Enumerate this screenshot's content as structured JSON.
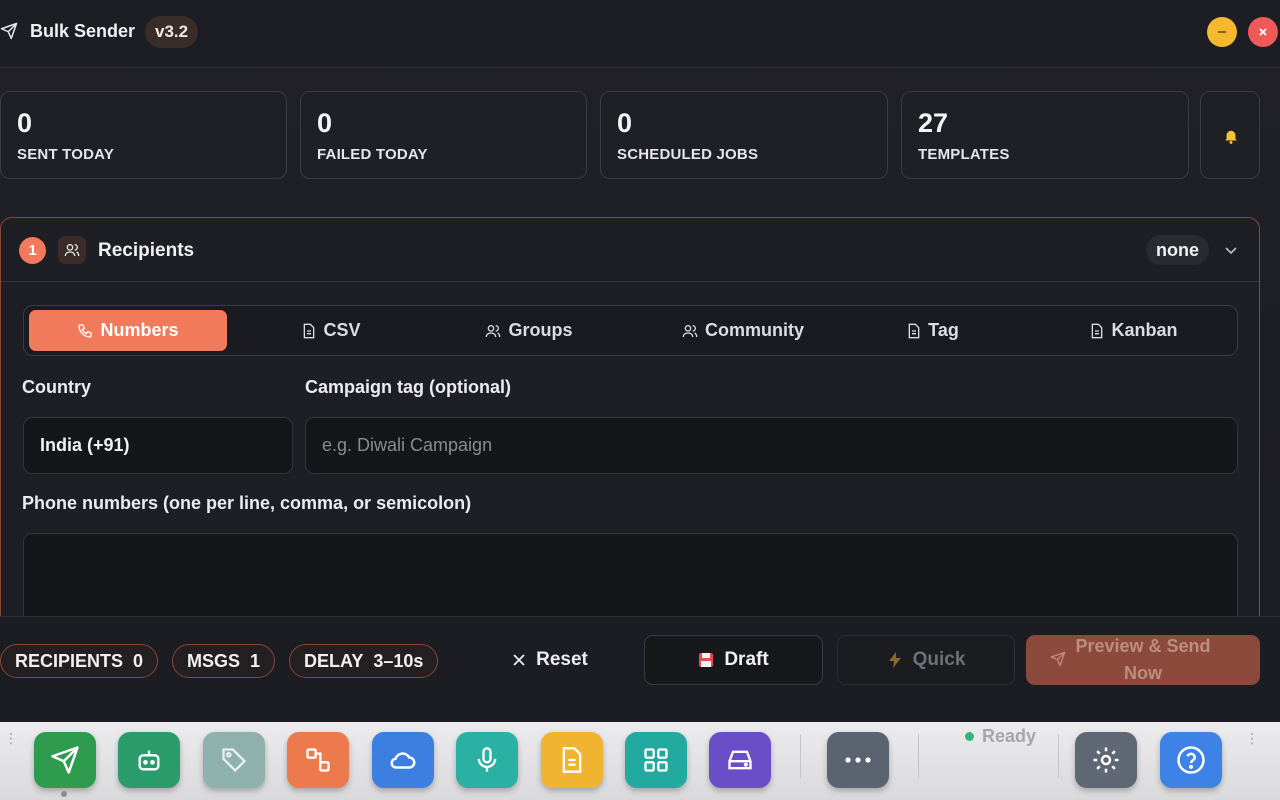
{
  "window": {
    "title": "Bulk Sender",
    "version": "v3.2",
    "title_icon": "send-icon",
    "minimize_icon": "minimize-icon",
    "close_icon": "close-icon"
  },
  "stats": [
    {
      "value": "0",
      "label": "SENT TODAY"
    },
    {
      "value": "0",
      "label": "FAILED TODAY"
    },
    {
      "value": "0",
      "label": "SCHEDULED JOBS"
    },
    {
      "value": "27",
      "label": "TEMPLATES"
    }
  ],
  "notifications_icon": "bell-icon",
  "recipients": {
    "step": "1",
    "title": "Recipients",
    "selection": "none",
    "tabs": [
      {
        "label": "Numbers",
        "icon": "phone-icon",
        "active": true
      },
      {
        "label": "CSV",
        "icon": "file-icon",
        "active": false
      },
      {
        "label": "Groups",
        "icon": "users-icon",
        "active": false
      },
      {
        "label": "Community",
        "icon": "users-icon",
        "active": false
      },
      {
        "label": "Tag",
        "icon": "file-icon",
        "active": false
      },
      {
        "label": "Kanban",
        "icon": "file-icon",
        "active": false
      }
    ],
    "country_label": "Country",
    "country_value": "India (+91)",
    "campaign_label": "Campaign tag (optional)",
    "campaign_placeholder": "e.g. Diwali Campaign",
    "campaign_value": "",
    "phones_label": "Phone numbers (one per line, comma, or semicolon)",
    "phones_value": ""
  },
  "actionbar": {
    "chips": [
      {
        "label": "RECIPIENTS",
        "value": "0"
      },
      {
        "label": "MSGS",
        "value": "1"
      },
      {
        "label": "DELAY",
        "value": "3–10s"
      }
    ],
    "reset_label": "Reset",
    "draft_label": "Draft",
    "quick_label": "Quick",
    "send_label_line1": "Preview & Send",
    "send_label_line2": "Now"
  },
  "dock": {
    "apps": [
      {
        "name": "send",
        "icon": "send-icon",
        "color": "#2e9b4e"
      },
      {
        "name": "bot",
        "icon": "bot-icon",
        "color": "#2a9c6c"
      },
      {
        "name": "tag",
        "icon": "tag-icon",
        "color": "#8fb1ad"
      },
      {
        "name": "flow",
        "icon": "flow-icon",
        "color": "#ec7a4c"
      },
      {
        "name": "cloud",
        "icon": "cloud-icon",
        "color": "#3c7fe0"
      },
      {
        "name": "mic",
        "icon": "mic-icon",
        "color": "#2bb1a4"
      },
      {
        "name": "document",
        "icon": "document-icon",
        "color": "#f0b430"
      },
      {
        "name": "grid",
        "icon": "grid-icon",
        "color": "#22a9a0"
      },
      {
        "name": "drive",
        "icon": "drive-icon",
        "color": "#6a4ec8"
      },
      {
        "name": "more",
        "icon": "more-icon",
        "color": "#5c6370"
      },
      {
        "name": "settings",
        "icon": "gear-icon",
        "color": "#5f6774"
      },
      {
        "name": "help",
        "icon": "help-icon",
        "color": "#3d82e4"
      }
    ],
    "status": "Ready",
    "status_color": "#35b37a"
  },
  "colors": {
    "accent": "#f07a5b",
    "background": "#1e1f24",
    "panel_border": "#8a4636"
  }
}
